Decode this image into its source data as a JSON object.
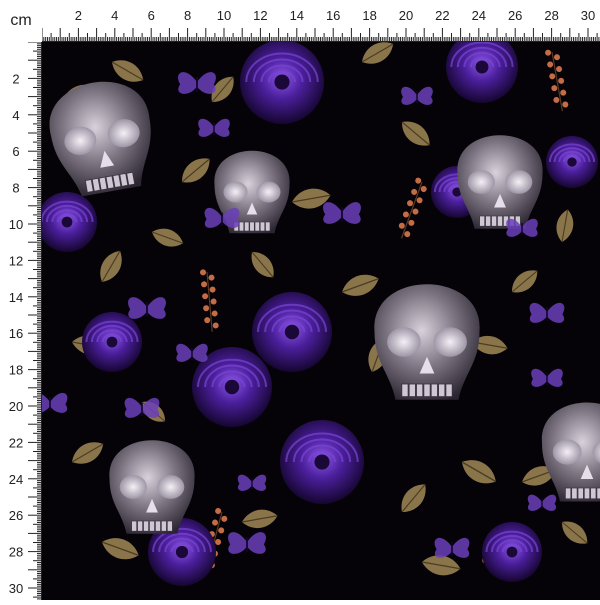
{
  "ruler": {
    "unit": "cm",
    "top_labels": [
      "2",
      "4",
      "6",
      "8",
      "10",
      "12",
      "14",
      "16",
      "18",
      "20",
      "22",
      "24",
      "26",
      "28",
      "30"
    ],
    "left_labels": [
      "2",
      "4",
      "6",
      "8",
      "10",
      "12",
      "14",
      "16",
      "18",
      "20",
      "22",
      "24",
      "26",
      "28",
      "30"
    ]
  },
  "colors": {
    "background": "#050308",
    "rose": "#4b1f9c",
    "rose_highlight": "#7b45d6",
    "leaf": "#a28a57",
    "skull": "#8a838e",
    "skull_highlight": "#e6e1ea",
    "berries": "#d9784e",
    "butterfly": "#6a3fb8"
  },
  "motifs": [
    "skull",
    "purple-rose",
    "leaf",
    "butterfly",
    "berry-sprig"
  ]
}
